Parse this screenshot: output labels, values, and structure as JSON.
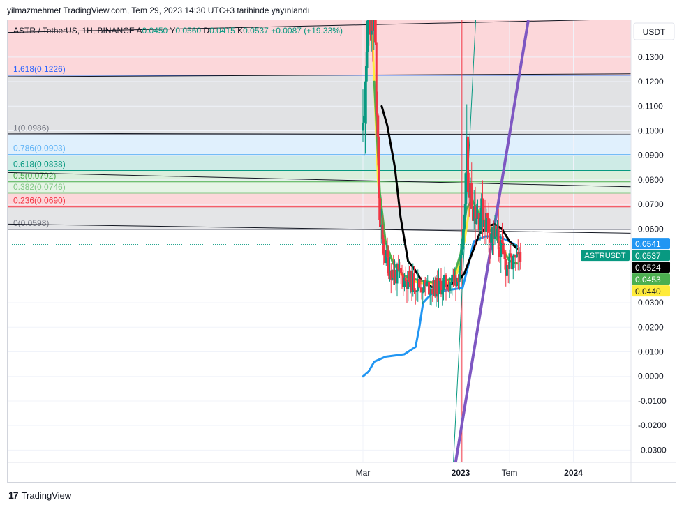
{
  "publish_line": "yilmazmehmet TradingView.com, Tem 29, 2023 14:30 UTC+3 tarihinde yayınlandı",
  "footer": {
    "brand": "TradingView",
    "logo_glyph": "17"
  },
  "chart_data": {
    "type": "candlestick",
    "legend": {
      "symbol": "ASTR / TetherUS, 1H, BINANCE",
      "open_label": "A",
      "open": "0.0450",
      "high_label": "Y",
      "high": "0.0560",
      "low_label": "D",
      "low": "0.0415",
      "close_label": "K",
      "close": "0.0537",
      "change": "+0.0087 (+19.33%)"
    },
    "currency": "USDT",
    "y_axis": {
      "range": [
        -0.035,
        0.145
      ],
      "ticks": [
        "0.1300",
        "0.1200",
        "0.1100",
        "0.1000",
        "0.0900",
        "0.0800",
        "0.0700",
        "0.0600",
        "0.0300",
        "0.0200",
        "0.0100",
        "0.0000",
        "-0.0100",
        "-0.0200",
        "-0.0300"
      ],
      "tick_values": [
        0.13,
        0.12,
        0.11,
        0.1,
        0.09,
        0.08,
        0.07,
        0.06,
        0.03,
        0.02,
        0.01,
        0.0,
        -0.01,
        -0.02,
        -0.03
      ]
    },
    "x_axis": {
      "labels": [
        {
          "text": "Mar",
          "t": 0.0,
          "bold": false
        },
        {
          "text": "2023",
          "t": 0.52,
          "bold": true
        },
        {
          "text": "Tem",
          "t": 0.78,
          "bold": false
        },
        {
          "text": "2024",
          "t": 1.12,
          "bold": true
        }
      ]
    },
    "fib_levels": [
      {
        "label": "1.618(0.1226)",
        "value": 0.1226,
        "color": "#2962ff"
      },
      {
        "label": "1(0.0986)",
        "value": 0.0986,
        "color": "#787b86"
      },
      {
        "label": "0.786(0.0903)",
        "value": 0.0903,
        "color": "#64b5f6"
      },
      {
        "label": "0.618(0.0838)",
        "value": 0.0838,
        "color": "#089981"
      },
      {
        "label": "0.5(0.0792)",
        "value": 0.0792,
        "color": "#4caf50"
      },
      {
        "label": "0.382(0.0746)",
        "value": 0.0746,
        "color": "#81c784"
      },
      {
        "label": "0.236(0.0690)",
        "value": 0.069,
        "color": "#f23645"
      },
      {
        "label": "0(0.0598)",
        "value": 0.0598,
        "color": "#787b86"
      }
    ],
    "price_tags": [
      {
        "text": "0.0541",
        "value": 0.0541,
        "bg": "#2196f3",
        "fg": "#ffffff"
      },
      {
        "text": "0.0537",
        "value": 0.0537,
        "bg": "#089981",
        "fg": "#ffffff"
      },
      {
        "text": "0.0524",
        "value": 0.0524,
        "bg": "#000000",
        "fg": "#ffffff"
      },
      {
        "text": "0.0453",
        "value": 0.0453,
        "bg": "#4caf50",
        "fg": "#ffffff"
      },
      {
        "text": "0.0440",
        "value": 0.044,
        "bg": "#ffeb3b",
        "fg": "#131722"
      }
    ],
    "symbol_tag": {
      "text": "ASTRUSDT",
      "value": 0.0537,
      "bg": "#089981"
    },
    "colors": {
      "up": "#089981",
      "down": "#f23645",
      "accent": "#2962ff"
    }
  }
}
